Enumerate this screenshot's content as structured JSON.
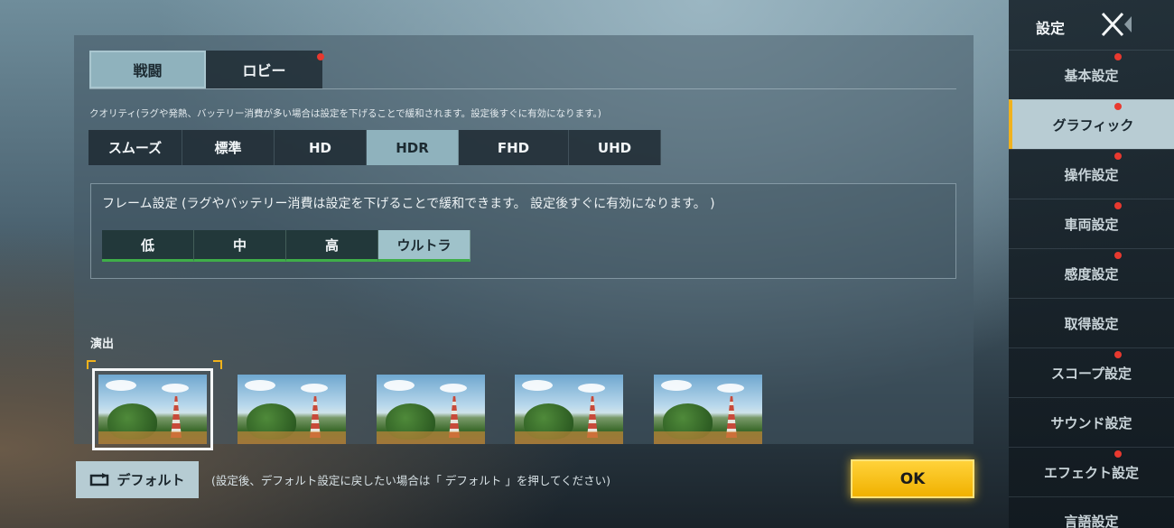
{
  "top_tabs": [
    {
      "label": "戦闘",
      "active": true
    },
    {
      "label": "ロビー",
      "active": false,
      "badge": true
    }
  ],
  "quality": {
    "caption": "クオリティ(ラグや発熱、バッテリー消費が多い場合は設定を下げることで緩和されます。設定後すぐに有効になります。)",
    "options": [
      "スムーズ",
      "標準",
      "HD",
      "HDR",
      "FHD",
      "UHD"
    ],
    "selected": "HDR"
  },
  "frame": {
    "caption": "フレーム設定 (ラグやバッテリー消費は設定を下げることで緩和できます。 設定後すぐに有効になります。 )",
    "options": [
      "低",
      "中",
      "高",
      "ウルトラ"
    ],
    "selected": "ウルトラ"
  },
  "effects": {
    "label": "演出",
    "thumbnail_count": 5,
    "selected_index": 0
  },
  "footer": {
    "default_label": "デフォルト",
    "hint": "(設定後、デフォルト設定に戻したい場合は「 デフォルト 」を押してください)",
    "ok_label": "OK"
  },
  "sidebar": {
    "title": "設定",
    "items": [
      {
        "label": "基本設定",
        "badge": true
      },
      {
        "label": "グラフィック",
        "badge": true,
        "active": true
      },
      {
        "label": "操作設定",
        "badge": true
      },
      {
        "label": "車両設定",
        "badge": true
      },
      {
        "label": "感度設定",
        "badge": true
      },
      {
        "label": "取得設定",
        "badge": false
      },
      {
        "label": "スコープ設定",
        "badge": true
      },
      {
        "label": "サウンド設定",
        "badge": false
      },
      {
        "label": "エフェクト設定",
        "badge": true
      },
      {
        "label": "言語設定",
        "badge": false
      }
    ]
  },
  "colors": {
    "accent": "#f0b21e",
    "selected": "#8fb2bd",
    "badge": "#e8392f",
    "frame_underline": "#3fae49"
  }
}
